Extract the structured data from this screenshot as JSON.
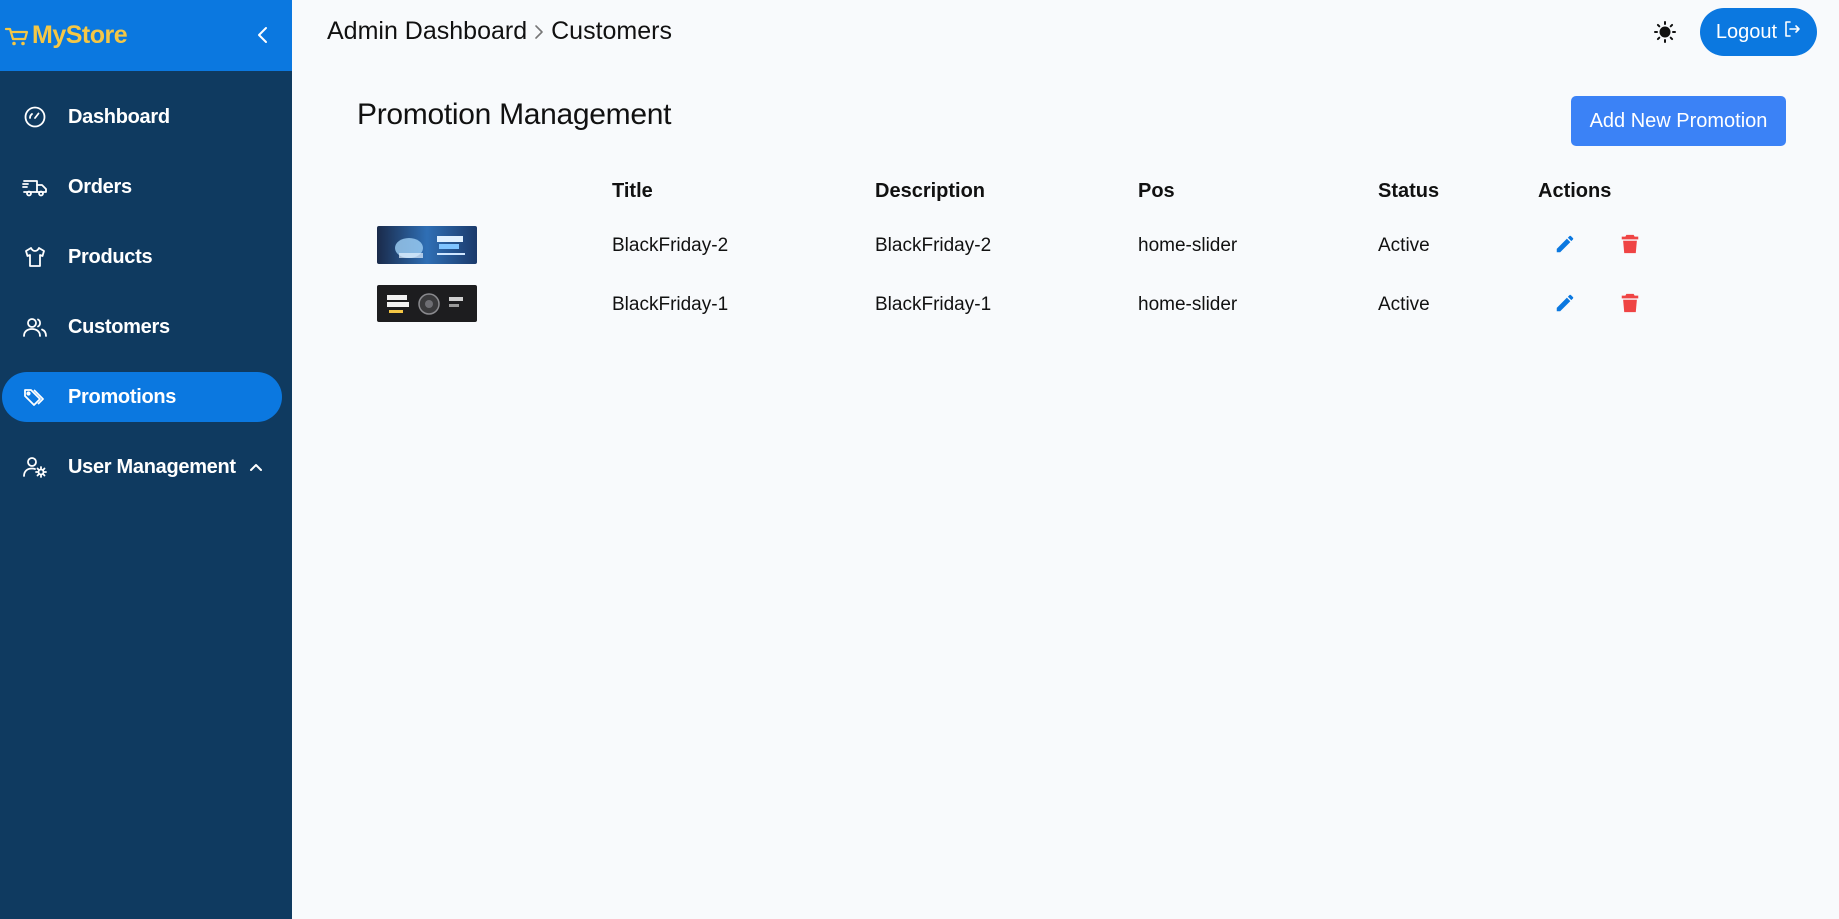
{
  "brand": {
    "name": "MyStore",
    "color": "#f5c745"
  },
  "sidebar": {
    "background": "#0f3a60",
    "items": [
      {
        "label": "Dashboard",
        "icon": "gauge-icon"
      },
      {
        "label": "Orders",
        "icon": "truck-icon"
      },
      {
        "label": "Products",
        "icon": "shirt-icon"
      },
      {
        "label": "Customers",
        "icon": "users-icon"
      },
      {
        "label": "Promotions",
        "icon": "tags-icon",
        "active": true
      },
      {
        "label": "User Management",
        "icon": "user-cog-icon",
        "expanded": true
      }
    ]
  },
  "breadcrumb": {
    "root": "Admin Dashboard",
    "current": "Customers"
  },
  "header": {
    "logout_label": "Logout",
    "accent": "#0b78e0"
  },
  "main": {
    "title": "Promotion Management",
    "add_button_label": "Add New Promotion",
    "columns": [
      "",
      "Title",
      "Description",
      "Pos",
      "Status",
      "Actions"
    ],
    "rows": [
      {
        "image": "blackfriday-2-banner",
        "title": "BlackFriday-2",
        "description": "BlackFriday-2",
        "pos": "home-slider",
        "status": "Active"
      },
      {
        "image": "blackfriday-1-banner",
        "title": "BlackFriday-1",
        "description": "BlackFriday-1",
        "pos": "home-slider",
        "status": "Active"
      }
    ],
    "edit_color": "#0b78e0",
    "delete_color": "#ef4444"
  }
}
